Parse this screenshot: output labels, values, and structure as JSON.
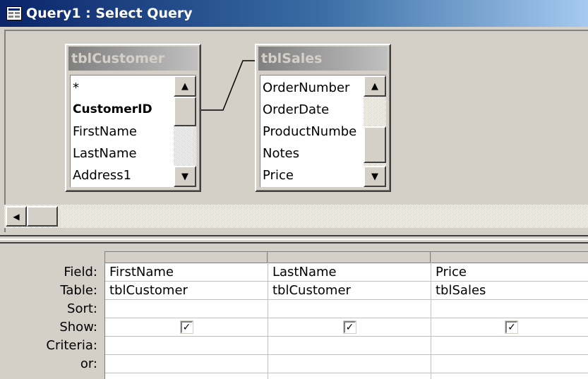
{
  "window": {
    "title": "Query1 : Select Query"
  },
  "tables": [
    {
      "name": "tblCustomer",
      "fields": [
        "*",
        "CustomerID",
        "FirstName",
        "LastName",
        "Address1"
      ],
      "bold_field": "CustomerID"
    },
    {
      "name": "tblSales",
      "fields": [
        "OrderNumber",
        "OrderDate",
        "ProductNumbe",
        "Notes",
        "Price"
      ]
    }
  ],
  "grid": {
    "row_labels": [
      "Field:",
      "Table:",
      "Sort:",
      "Show:",
      "Criteria:",
      "or:"
    ],
    "columns": [
      {
        "field": "FirstName",
        "table": "tblCustomer",
        "sort": "",
        "show": true,
        "criteria": "",
        "or": ""
      },
      {
        "field": "LastName",
        "table": "tblCustomer",
        "sort": "",
        "show": true,
        "criteria": "",
        "or": ""
      },
      {
        "field": "Price",
        "table": "tblSales",
        "sort": "",
        "show": true,
        "criteria": "",
        "or": ""
      }
    ]
  },
  "icons": {
    "window": "query-window-icon",
    "scroll_up": "arrow-up-icon",
    "scroll_down": "arrow-down-icon",
    "scroll_left": "arrow-left-icon",
    "checkbox": "checkmark-icon"
  },
  "colors": {
    "titlebar_start": "#0a246a",
    "titlebar_end": "#a6caf0",
    "face": "#d4d0c8",
    "inactive_title_start": "#808080"
  }
}
